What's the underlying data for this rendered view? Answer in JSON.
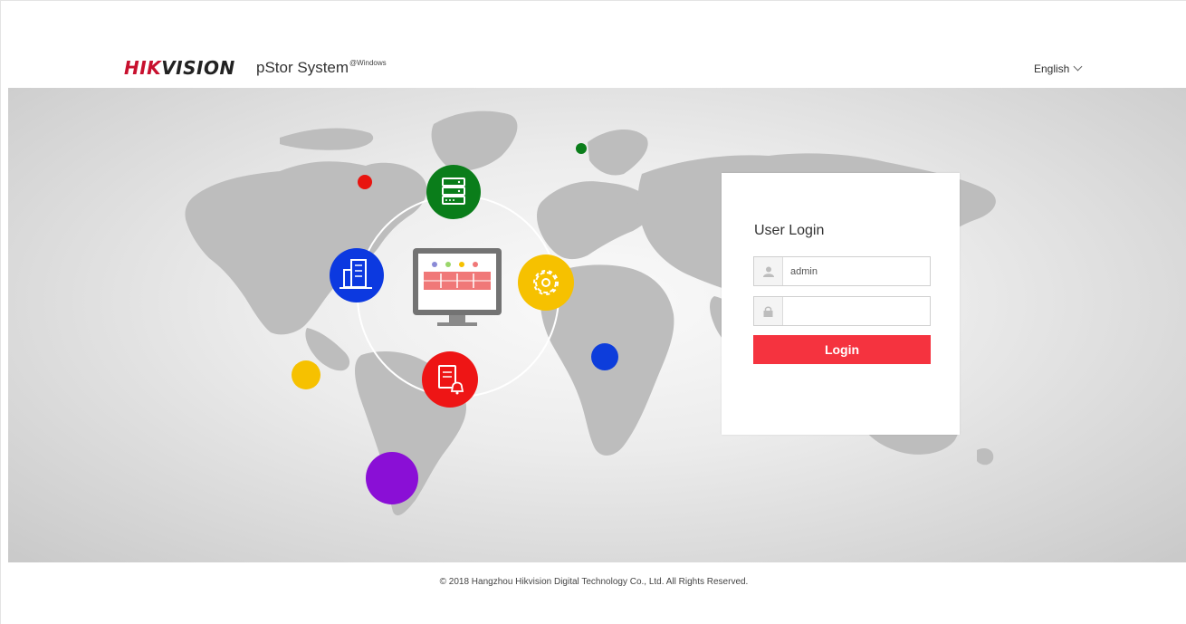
{
  "header": {
    "logo_hik": "HIK",
    "logo_vision": "VISION",
    "product_name": "pStor System",
    "product_suffix": "@Windows",
    "language": "English"
  },
  "banner": {
    "colors": {
      "server_circle": "#0a7d1a",
      "building_circle": "#0c39e0",
      "settings_circle": "#f6c100",
      "alarm_circle": "#ee1515",
      "red_dot": "#e8140f",
      "green_dot": "#0a7d1a",
      "blue_dot": "#0d3ddb",
      "yellow_dot": "#f6c100",
      "purple_dot": "#8a0fd6",
      "monitor_frame": "#737373",
      "monitor_screen_bar": "#f07878"
    },
    "icons": [
      "server-icon",
      "building-icon",
      "settings-gear-icon",
      "report-alarm-icon",
      "monitor-icon"
    ]
  },
  "login": {
    "title": "User Login",
    "username_value": "admin",
    "password_value": "",
    "button_label": "Login",
    "user_icon": "user-icon",
    "lock_icon": "lock-icon",
    "accent_color": "#f5333f"
  },
  "footer": {
    "copyright": "© 2018 Hangzhou Hikvision Digital Technology Co., Ltd. All Rights Reserved."
  }
}
